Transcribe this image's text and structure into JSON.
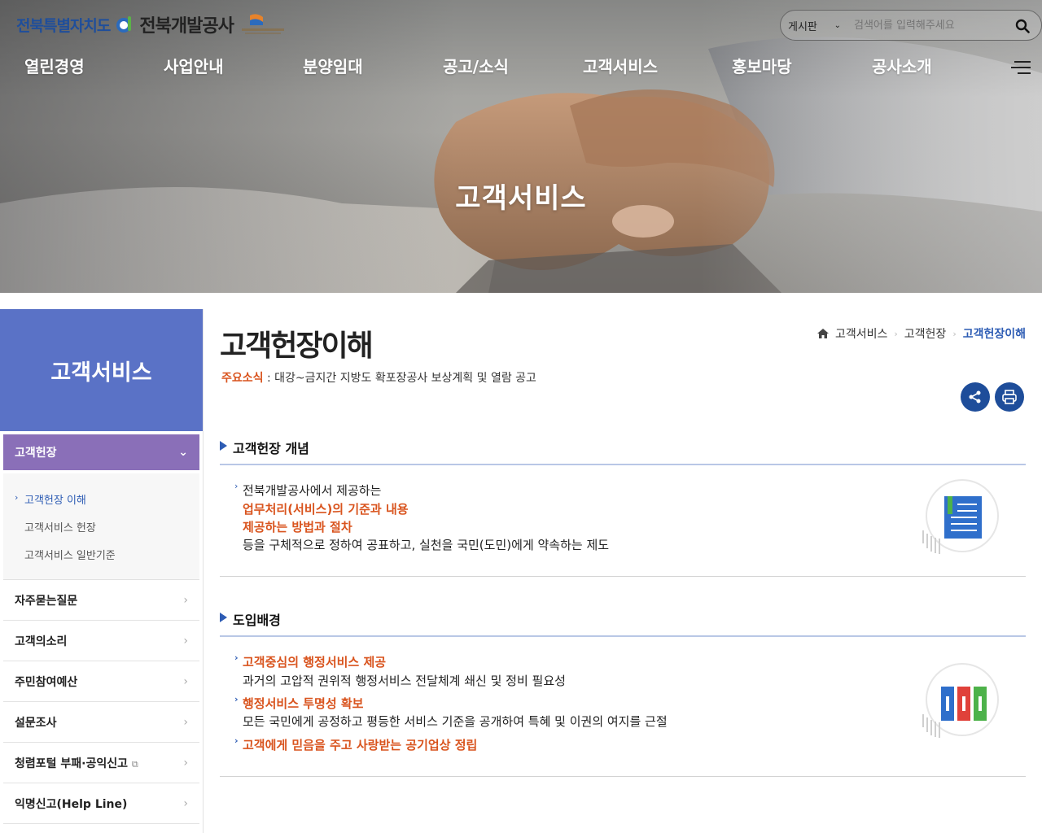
{
  "header": {
    "logo_region_a": "전북",
    "logo_region_b": "특별자치도",
    "logo_corp": "전북개발공사",
    "search": {
      "category": "게시판",
      "placeholder": "검색어를 입력해주세요"
    },
    "gnb": [
      "열린경영",
      "사업안내",
      "분양임대",
      "공고/소식",
      "고객서비스",
      "홍보마당",
      "공사소개"
    ]
  },
  "hero": {
    "title": "고객서비스"
  },
  "lnb": {
    "title": "고객서비스",
    "active": "고객헌장",
    "sub": [
      "고객헌장 이해",
      "고객서비스 헌장",
      "고객서비스 일반기준"
    ],
    "menus": [
      "자주묻는질문",
      "고객의소리",
      "주민참여예산",
      "설문조사",
      "청렴포털 부패·공익신고",
      "익명신고(Help Line)"
    ]
  },
  "content": {
    "title": "고객헌장이해",
    "breadcrumb": [
      "고객서비스",
      "고객헌장",
      "고객헌장이해"
    ],
    "news_label": "주요소식",
    "news_text": " : 대강~금지간 지방도 확포장공사 보상계획 및 열람 공고",
    "section1": {
      "title": "고객헌장 개념",
      "lines": [
        "전북개발공사에서 제공하는",
        "업무처리(서비스)의 기준과 내용",
        "제공하는 방법과 절차",
        "등을 구체적으로 정하여 공표하고, 실천을 국민(도민)에게 약속하는 제도"
      ]
    },
    "section2": {
      "title": "도입배경",
      "items": [
        {
          "head": "고객중심의 행정서비스 제공",
          "desc": "과거의 고압적 권위적 행정서비스 전달체계 쇄신 및 정비 필요성"
        },
        {
          "head": "행정서비스 투명성 확보",
          "desc": "모든 국민에게 공정하고 평등한 서비스 기준을 공개하여 특혜 및 이권의 여지를 근절"
        },
        {
          "head": "고객에게 믿음을 주고 사랑받는 공기업상 정립",
          "desc": ""
        }
      ]
    }
  }
}
